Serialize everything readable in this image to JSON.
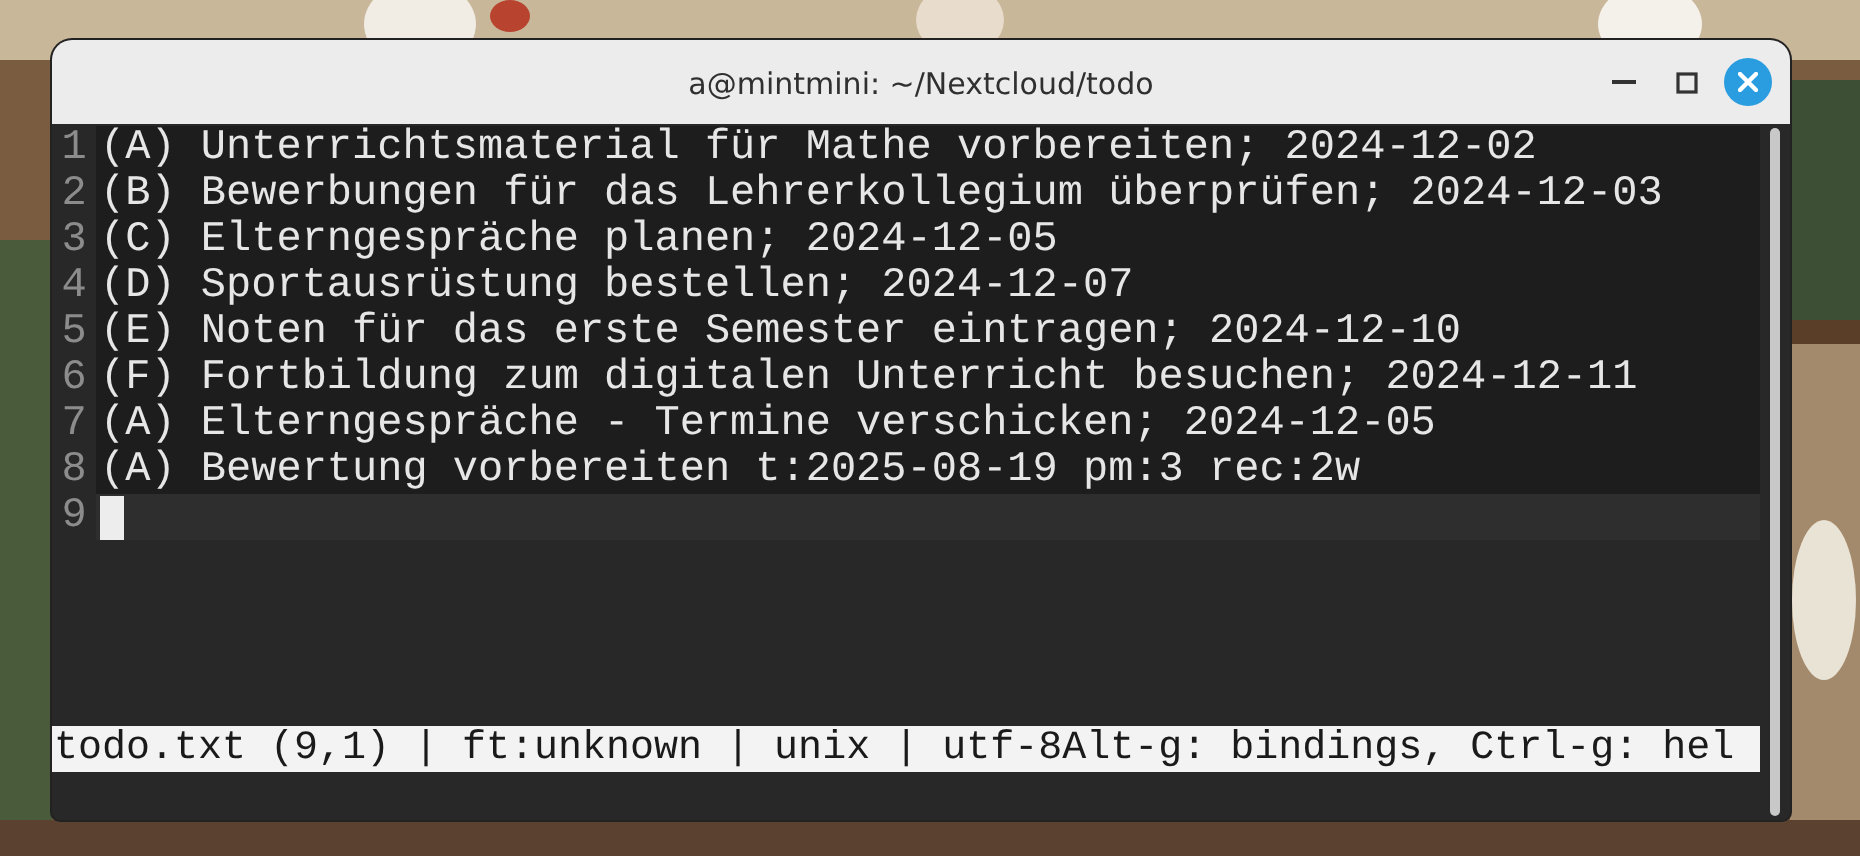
{
  "window": {
    "title": "a@mintmini: ~/Nextcloud/todo"
  },
  "lines": [
    {
      "number": "1",
      "text": "(A) Unterrichtsmaterial für Mathe vorbereiten; 2024-12-02",
      "current": false
    },
    {
      "number": "2",
      "text": "(B) Bewerbungen für das Lehrerkollegium überprüfen; 2024-12-03",
      "current": false
    },
    {
      "number": "3",
      "text": "(C) Elterngespräche planen; 2024-12-05",
      "current": false
    },
    {
      "number": "4",
      "text": "(D) Sportausrüstung bestellen; 2024-12-07",
      "current": false
    },
    {
      "number": "5",
      "text": "(E) Noten für das erste Semester eintragen; 2024-12-10",
      "current": false
    },
    {
      "number": "6",
      "text": "(F) Fortbildung zum digitalen Unterricht besuchen; 2024-12-11",
      "current": false
    },
    {
      "number": "7",
      "text": "(A) Elterngespräche - Termine verschicken; 2024-12-05",
      "current": false
    },
    {
      "number": "8",
      "text": "(A) Bewertung vorbereiten t:2025-08-19 pm:3 rec:2w",
      "current": false
    },
    {
      "number": "9",
      "current": true
    }
  ],
  "status_bar": "todo.txt (9,1) | ft:unknown | unix | utf-8Alt-g: bindings, Ctrl-g: hel"
}
